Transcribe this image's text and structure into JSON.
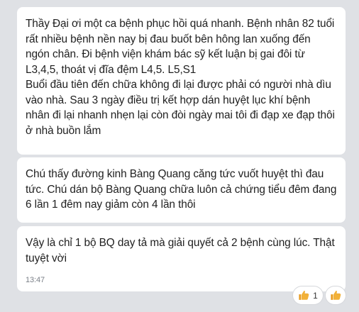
{
  "messages": [
    {
      "text": "Thầy Đại ơi một ca bệnh phục hồi quá nhanh. Bệnh nhân 82 tuổi rất nhiều bệnh nền nay bị đau buốt bên hông lan xuống đến ngón chân. Đi bệnh viện khám bác sỹ kết luận bị gai đôi từ L3,4,5, thoát vị đĩa đệm L4,5. L5,S1\nBuổi đầu tiên đến chữa không đi lại được phải có người nhà dìu vào nhà. Sau 3 ngày điều trị kết hợp dán huyệt lục khí bệnh nhân đi lại nhanh nhẹn lại còn đòi ngày mai tôi đi đạp xe đạp thôi ở nhà buồn lắm"
    },
    {
      "text": "Chú thấy đường kinh Bàng Quang căng tức vuốt huyệt thì đau tức. Chú dán bộ Bàng Quang chữa luôn cả chứng tiểu đêm đang 6 lần 1 đêm nay giảm còn 4 lần thôi"
    },
    {
      "text": "Vậy là chỉ 1 bộ BQ day tả mà giải quyết cả 2 bệnh cùng lúc. Thật tuyệt vời",
      "time": "13:47"
    }
  ],
  "reactions": {
    "icon": "thumbs-up-icon",
    "count": "1",
    "accent_color": "#f2b138"
  }
}
